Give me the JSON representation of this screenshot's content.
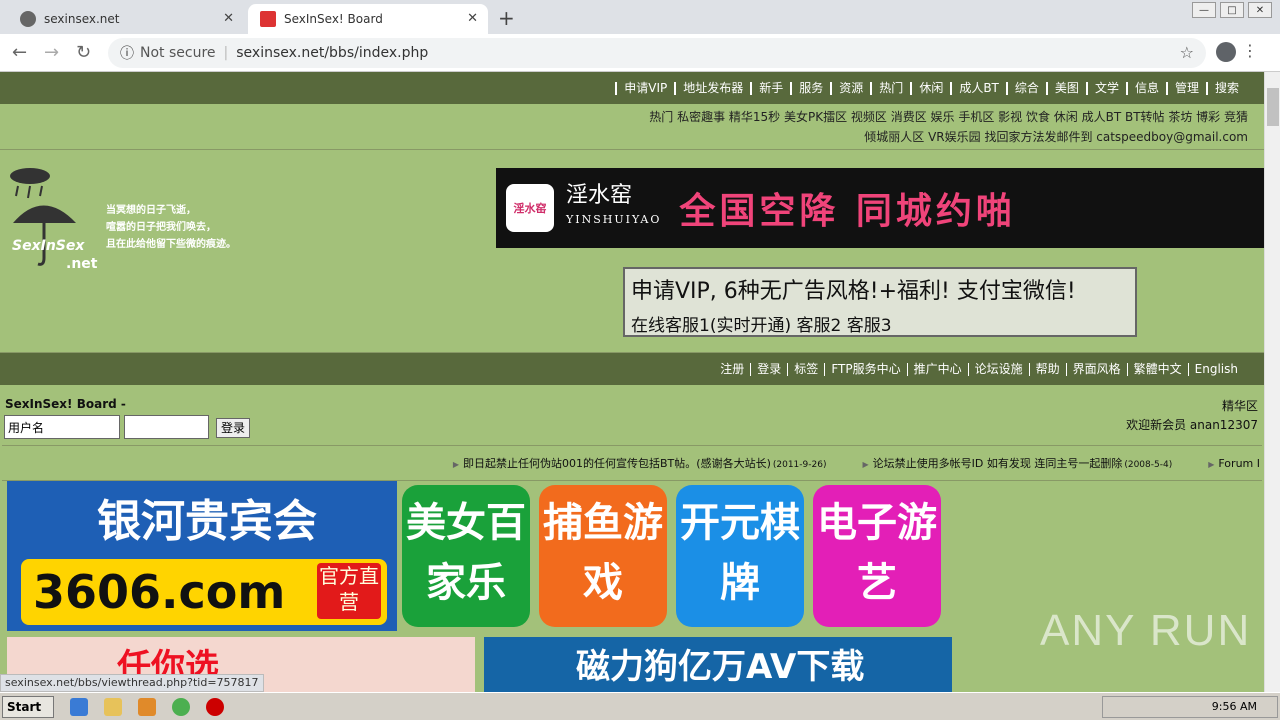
{
  "browser": {
    "tabs": [
      {
        "title": "sexinsex.net",
        "active": false
      },
      {
        "title": "SexInSex! Board",
        "active": true
      }
    ],
    "url_security": "Not secure",
    "url": "sexinsex.net/bbs/index.php",
    "status_url": "sexinsex.net/bbs/viewthread.php?tid=757817"
  },
  "topnav": [
    "申请VIP",
    "地址发布器",
    "新手",
    "服务",
    "资源",
    "热门",
    "休闲",
    "成人BT",
    "综合",
    "美图",
    "文学",
    "信息",
    "管理",
    "搜索"
  ],
  "subnav_line1": "热门 私密趣事 精华15秒 美女PK擂区 视频区 消费区 娱乐 手机区 影视 饮食 休闲 成人BT BT转帖 茶坊 博彩 竞猜",
  "subnav_line2": "倾城丽人区 VR娱乐园 找回家方法发邮件到 catspeedboy@gmail.com",
  "logo": {
    "tagline1": "当冥想的日子飞逝，",
    "tagline2": "喧嚣的日子把我们唤去，",
    "tagline3": "且在此给他留下些微的痕迹。",
    "brand": "SexInSex",
    "brand_suffix": ".net"
  },
  "banner_ad": {
    "app_icon": "淫水窑",
    "name": "淫水窑",
    "name_pinyin": "YINSHUIYAO",
    "slogan": "全国空降  同城约啪"
  },
  "vip_box": {
    "line1": "申请VIP, 6种无广告风格!+福利! 支付宝微信!",
    "line2": "在线客服1(实时开通) 客服2 客服3"
  },
  "usernav": [
    "注册",
    "登录",
    "标签",
    "FTP服务中心",
    "推广中心",
    "论坛设施",
    "帮助",
    "界面风格",
    "繁體中文",
    "English"
  ],
  "login": {
    "board_title": "SexInSex! Board -",
    "username_value": "用户名",
    "password_value": "",
    "submit": "登录",
    "digest": "精华区",
    "welcome": "欢迎新会员 anan12307"
  },
  "announcements": [
    {
      "text": "即日起禁止任何伪站001的任何宣传包括BT帖。(感谢各大站长)",
      "date": "(2011-9-26)"
    },
    {
      "text": "论坛禁止使用多帐号ID 如有发现 连同主号一起删除",
      "date": "(2008-5-4)"
    },
    {
      "text": "Forum I",
      "date": ""
    }
  ],
  "ads": {
    "galaxy_title": "银河贵宾会",
    "galaxy_site": "3606.com",
    "galaxy_badge": "官方直营",
    "tiles": [
      {
        "text": "美女百家乐",
        "color": "#1aa13a"
      },
      {
        "text": "捕鱼游戏",
        "color": "#f26b1d"
      },
      {
        "text": "开元棋牌",
        "color": "#1b8fe6"
      },
      {
        "text": "电子游艺",
        "color": "#e31fb7"
      }
    ],
    "ad3_text": "任你选",
    "ad4_text": "磁力狗亿万AV下载"
  },
  "watermark": "ANY RUN",
  "taskbar": {
    "start": "Start",
    "time": "9:56 AM"
  }
}
